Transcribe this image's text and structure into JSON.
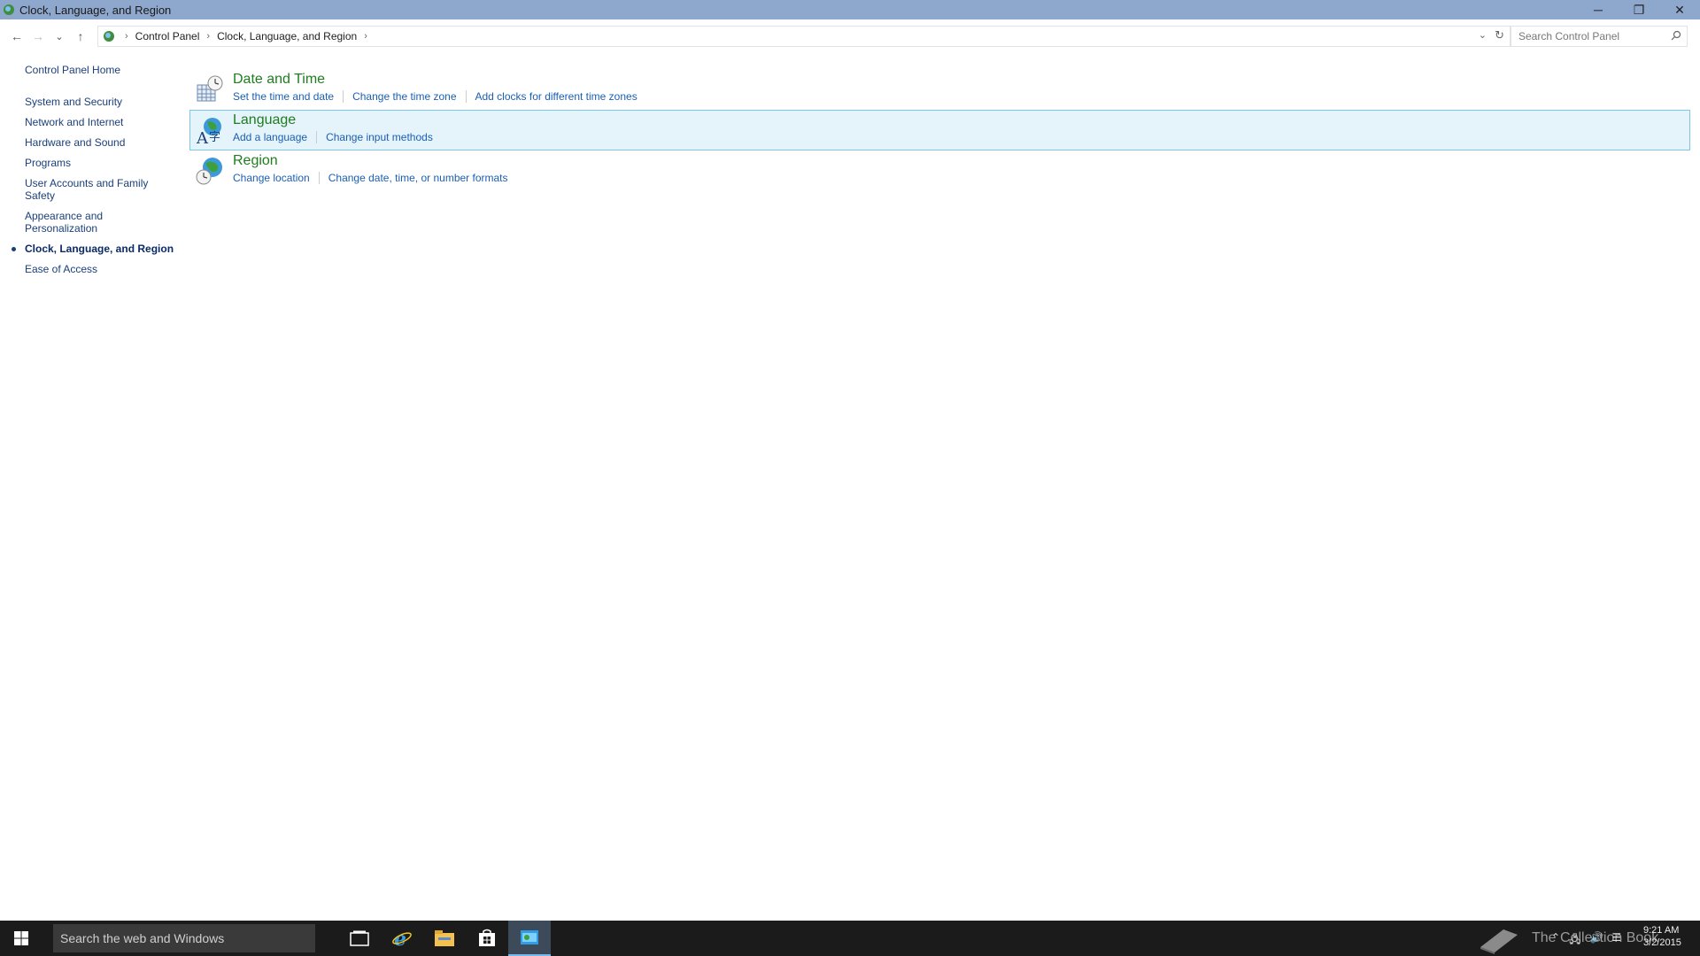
{
  "window": {
    "title": "Clock, Language, and Region",
    "controls": {
      "minimize": "─",
      "restore": "❐",
      "close": "✕"
    }
  },
  "nav": {
    "back": "←",
    "forward": "→",
    "recent": "⌄",
    "up": "↑",
    "breadcrumbs": [
      "Control Panel",
      "Clock, Language, and Region"
    ],
    "search_placeholder": "Search Control Panel"
  },
  "sidebar": {
    "home": "Control Panel Home",
    "items": [
      {
        "label": "System and Security",
        "active": false
      },
      {
        "label": "Network and Internet",
        "active": false
      },
      {
        "label": "Hardware and Sound",
        "active": false
      },
      {
        "label": "Programs",
        "active": false
      },
      {
        "label": "User Accounts and Family Safety",
        "active": false
      },
      {
        "label": "Appearance and Personalization",
        "active": false
      },
      {
        "label": "Clock, Language, and Region",
        "active": true
      },
      {
        "label": "Ease of Access",
        "active": false
      }
    ]
  },
  "categories": [
    {
      "title": "Date and Time",
      "icon": "clock-calendar-icon",
      "links": [
        "Set the time and date",
        "Change the time zone",
        "Add clocks for different time zones"
      ]
    },
    {
      "title": "Language",
      "icon": "language-globe-icon",
      "links": [
        "Add a language",
        "Change input methods"
      ]
    },
    {
      "title": "Region",
      "icon": "region-globe-icon",
      "links": [
        "Change location",
        "Change date, time, or number formats"
      ]
    }
  ],
  "taskbar": {
    "search_placeholder": "Search the web and Windows",
    "watermark": "The Collection Book",
    "clock_time": "9:21 AM",
    "clock_date": "3/2/2015"
  },
  "colors": {
    "titlebar": "#8da7cd",
    "category_title": "#1e7d1e",
    "link": "#1a5fb4",
    "highlight_bg": "#e5f3fb",
    "highlight_border": "#7fc5e8",
    "taskbar": "#1b1b1b"
  }
}
